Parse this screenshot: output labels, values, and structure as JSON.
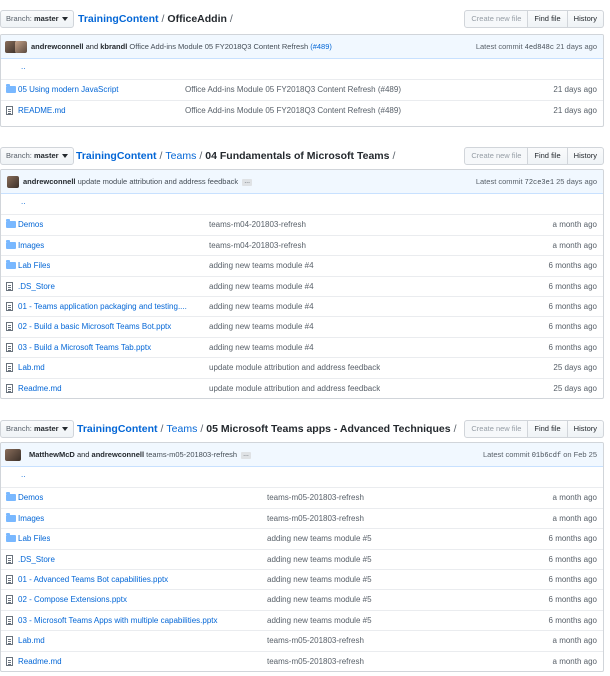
{
  "sections": [
    {
      "branch_prefix": "Branch:",
      "branch": "master",
      "breadcrumb": {
        "repo": "TrainingContent",
        "path": [],
        "current": "OfficeAddin",
        "trail": "/"
      },
      "buttons": {
        "create": "Create new file",
        "find": "Find file",
        "history": "History"
      },
      "commit": {
        "authors": [
          "andrewconnell",
          "kbrandl"
        ],
        "joiner": "and",
        "message": "Office Add-ins Module 05 FY2018Q3 Content Refresh",
        "pr": "(#489)",
        "latest_label": "Latest commit",
        "sha": "4ed848c",
        "age": "21 days ago"
      },
      "up": "..",
      "rows": [
        {
          "type": "folder",
          "name": "05 Using modern JavaScript",
          "message": "Office Add-ins Module 05 FY2018Q3 Content Refresh (#489)",
          "age": "21 days ago"
        },
        {
          "type": "file",
          "name": "README.md",
          "message": "Office Add-ins Module 05 FY2018Q3 Content Refresh (#489)",
          "age": "21 days ago"
        }
      ]
    },
    {
      "branch_prefix": "Branch:",
      "branch": "master",
      "breadcrumb": {
        "repo": "TrainingContent",
        "path": [
          "Teams"
        ],
        "current": "04 Fundamentals of Microsoft Teams",
        "trail": "/"
      },
      "buttons": {
        "create": "Create new file",
        "find": "Find file",
        "history": "History"
      },
      "commit": {
        "authors": [
          "andrewconnell"
        ],
        "joiner": "",
        "message": "update module attribution and address feedback",
        "pr": "",
        "ellipsis": "…",
        "latest_label": "Latest commit",
        "sha": "72ce3e1",
        "age": "25 days ago"
      },
      "up": "..",
      "rows": [
        {
          "type": "folder",
          "name": "Demos",
          "message": "teams-m04-201803-refresh",
          "age": "a month ago"
        },
        {
          "type": "folder",
          "name": "Images",
          "message": "teams-m04-201803-refresh",
          "age": "a month ago"
        },
        {
          "type": "folder",
          "name": "Lab Files",
          "message": "adding new teams module #4",
          "age": "6 months ago"
        },
        {
          "type": "file",
          "name": ".DS_Store",
          "message": "adding new teams module #4",
          "age": "6 months ago"
        },
        {
          "type": "file",
          "name": "01 - Teams application packaging and testing....",
          "message": "adding new teams module #4",
          "age": "6 months ago"
        },
        {
          "type": "file",
          "name": "02 - Build a basic Microsoft Teams Bot.pptx",
          "message": "adding new teams module #4",
          "age": "6 months ago"
        },
        {
          "type": "file",
          "name": "03 - Build a Microsoft Teams Tab.pptx",
          "message": "adding new teams module #4",
          "age": "6 months ago"
        },
        {
          "type": "file",
          "name": "Lab.md",
          "message": "update module attribution and address feedback",
          "age": "25 days ago"
        },
        {
          "type": "file",
          "name": "Readme.md",
          "message": "update module attribution and address feedback",
          "age": "25 days ago"
        }
      ]
    },
    {
      "branch_prefix": "Branch:",
      "branch": "master",
      "breadcrumb": {
        "repo": "TrainingContent",
        "path": [
          "Teams"
        ],
        "current": "05 Microsoft Teams apps - Advanced Techniques",
        "trail": "/"
      },
      "buttons": {
        "create": "Create new file",
        "find": "Find file",
        "history": "History"
      },
      "commit": {
        "authors": [
          "MatthewMcD",
          "andrewconnell"
        ],
        "joiner": "and",
        "message": "teams-m05-201803-refresh",
        "pr": "",
        "ellipsis": "…",
        "latest_label": "Latest commit",
        "sha": "01b6cdf",
        "age": "on Feb 25"
      },
      "up": "..",
      "rows": [
        {
          "type": "folder",
          "name": "Demos",
          "message": "teams-m05-201803-refresh",
          "age": "a month ago"
        },
        {
          "type": "folder",
          "name": "Images",
          "message": "teams-m05-201803-refresh",
          "age": "a month ago"
        },
        {
          "type": "folder",
          "name": "Lab Files",
          "message": "adding new teams module #5",
          "age": "6 months ago"
        },
        {
          "type": "file",
          "name": ".DS_Store",
          "message": "adding new teams module #5",
          "age": "6 months ago"
        },
        {
          "type": "file",
          "name": "01 - Advanced Teams Bot capabilities.pptx",
          "message": "adding new teams module #5",
          "age": "6 months ago"
        },
        {
          "type": "file",
          "name": "02 - Compose Extensions.pptx",
          "message": "adding new teams module #5",
          "age": "6 months ago"
        },
        {
          "type": "file",
          "name": "03 - Microsoft Teams Apps with multiple capabilities.pptx",
          "message": "adding new teams module #5",
          "age": "6 months ago"
        },
        {
          "type": "file",
          "name": "Lab.md",
          "message": "teams-m05-201803-refresh",
          "age": "a month ago"
        },
        {
          "type": "file",
          "name": "Readme.md",
          "message": "teams-m05-201803-refresh",
          "age": "a month ago"
        }
      ]
    }
  ]
}
